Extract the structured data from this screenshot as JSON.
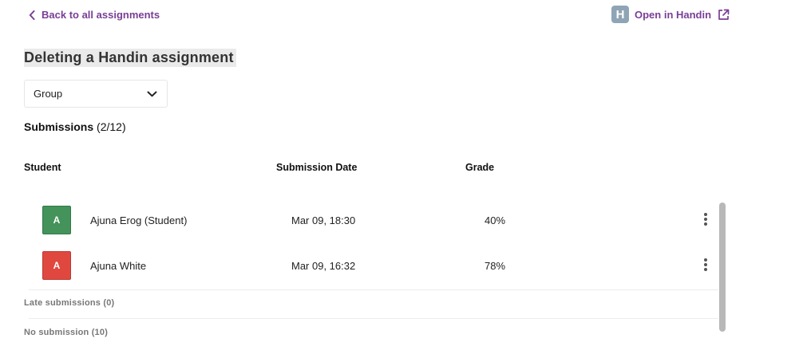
{
  "nav": {
    "back_label": "Back to all assignments",
    "open_label": "Open in Handin",
    "logo_letter": "H"
  },
  "page": {
    "title": "Deleting a Handin assignment"
  },
  "group_select": {
    "value": "Group"
  },
  "submissions": {
    "label": "Submissions",
    "count": "(2/12)"
  },
  "table": {
    "headers": [
      "Student",
      "Submission Date",
      "Grade"
    ],
    "rows": [
      {
        "initial": "A",
        "avatar_color": "#44935a",
        "name": "Ajuna Erog (Student)",
        "date": "Mar 09, 18:30",
        "grade": "40%"
      },
      {
        "initial": "A",
        "avatar_color": "#e0483f",
        "name": "Ajuna White",
        "date": "Mar 09, 16:32",
        "grade": "78%"
      }
    ]
  },
  "sections": {
    "late": "Late submissions (0)",
    "none": "No submission (10)"
  },
  "colors": {
    "accent": "#7a3e96",
    "logo_bg": "#8fa5b5"
  },
  "icons": {
    "back": "chevron-left-icon",
    "external": "external-link-icon",
    "dropdown": "chevron-down-icon",
    "row_menu": "more-vertical-icon"
  }
}
